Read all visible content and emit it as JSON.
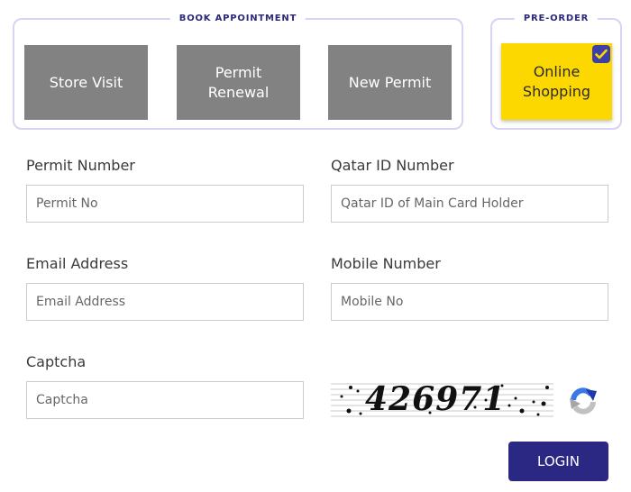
{
  "book_appointment": {
    "legend": "BOOK APPOINTMENT",
    "tiles": [
      {
        "label": "Store Visit"
      },
      {
        "label": "Permit Renewal"
      },
      {
        "label": "New Permit"
      }
    ]
  },
  "pre_order": {
    "legend": "PRE-ORDER",
    "tile": {
      "label": "Online Shopping",
      "selected": true
    }
  },
  "form": {
    "permit_number": {
      "label": "Permit Number",
      "placeholder": "Permit No",
      "value": ""
    },
    "qatar_id": {
      "label": "Qatar ID Number",
      "placeholder": "Qatar ID of Main Card Holder",
      "value": ""
    },
    "email": {
      "label": "Email Address",
      "placeholder": "Email Address",
      "value": ""
    },
    "mobile": {
      "label": "Mobile Number",
      "placeholder": "Mobile No",
      "value": ""
    },
    "captcha": {
      "label": "Captcha",
      "placeholder": "Captcha",
      "value": "",
      "image_text": "426971"
    }
  },
  "icons": {
    "refresh": "recaptcha-refresh-icon",
    "check": "checkmark-icon"
  },
  "colors": {
    "accent": "#2b2883",
    "tile_gray": "#828282",
    "tile_selected": "#fdd800",
    "border": "#d6d4f2"
  },
  "login_button": {
    "label": "LOGIN"
  }
}
